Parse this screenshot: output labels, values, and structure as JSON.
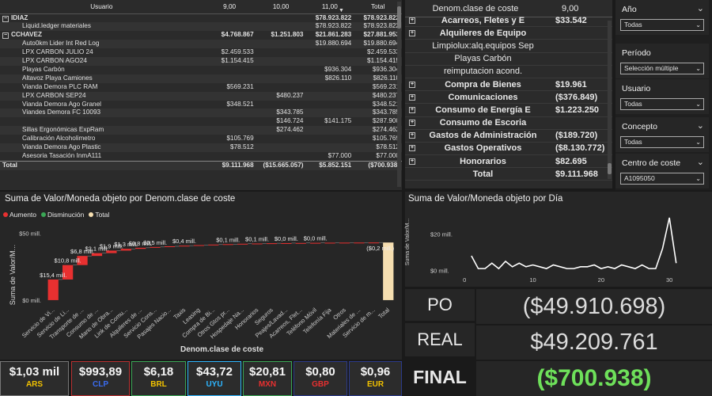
{
  "pivot": {
    "headers": [
      "Usuario",
      "9,00",
      "10,00",
      "11,00",
      "Total"
    ],
    "rows": [
      {
        "type": "grp",
        "expand": "⊟",
        "label": "IDIAZ",
        "c1": "",
        "c2": "",
        "c3": "$78.923.822",
        "c4": "$78.923.822"
      },
      {
        "type": "item",
        "label": "Liquid.ledger materiales",
        "c1": "",
        "c2": "",
        "c3": "$78.923.822",
        "c4": "$78.923.822"
      },
      {
        "type": "grp",
        "expand": "⊟",
        "label": "CCHAVEZ",
        "c1": "$4.768.867",
        "c2": "$1.251.803",
        "c3": "$21.861.283",
        "c4": "$27.881.953"
      },
      {
        "type": "item",
        "label": "Auto0km Lider Int Red Log",
        "c1": "",
        "c2": "",
        "c3": "$19.880.694",
        "c4": "$19.880.694"
      },
      {
        "type": "item",
        "label": "LPX CARBON JULIO 24",
        "c1": "$2.459.533",
        "c2": "",
        "c3": "",
        "c4": "$2.459.533"
      },
      {
        "type": "item",
        "label": "LPX CARBON AGO24",
        "c1": "$1.154.415",
        "c2": "",
        "c3": "",
        "c4": "$1.154.415"
      },
      {
        "type": "item",
        "label": "Playas Carbón",
        "c1": "",
        "c2": "",
        "c3": "$936.304",
        "c4": "$936.304"
      },
      {
        "type": "item",
        "label": "Altavoz Playa Camiones",
        "c1": "",
        "c2": "",
        "c3": "$826.110",
        "c4": "$826.110"
      },
      {
        "type": "item",
        "label": "Vianda Demora PLC RAM",
        "c1": "$569.231",
        "c2": "",
        "c3": "",
        "c4": "$569.231"
      },
      {
        "type": "item",
        "label": "LPX CARBON SEP24",
        "c1": "",
        "c2": "$480.237",
        "c3": "",
        "c4": "$480.237"
      },
      {
        "type": "item",
        "label": "Vianda Demora Ago Granel",
        "c1": "$348.521",
        "c2": "",
        "c3": "",
        "c4": "$348.521"
      },
      {
        "type": "item",
        "label": "Viandes Demora FC 10093",
        "c1": "",
        "c2": "$343.785",
        "c3": "",
        "c4": "$343.785"
      },
      {
        "type": "item",
        "label": "",
        "c1": "",
        "c2": "$146.724",
        "c3": "$141.175",
        "c4": "$287.900"
      },
      {
        "type": "item",
        "label": "Sillas Ergonómicas ExpRam",
        "c1": "",
        "c2": "$274.462",
        "c3": "",
        "c4": "$274.462"
      },
      {
        "type": "item",
        "label": "Calibración Alcoholimetro",
        "c1": "$105.769",
        "c2": "",
        "c3": "",
        "c4": "$105.769"
      },
      {
        "type": "item",
        "label": "Vianda Demora Ago Plastic",
        "c1": "$78.512",
        "c2": "",
        "c3": "",
        "c4": "$78.512"
      },
      {
        "type": "item",
        "label": "Asesoria Tasación InmA111",
        "c1": "",
        "c2": "",
        "c3": "$77.000",
        "c4": "$77.000"
      },
      {
        "type": "tot",
        "label": "Total",
        "c1": "$9.111.968",
        "c2": "($15.665.057)",
        "c3": "$5.852.151",
        "c4": "($700.938)"
      }
    ]
  },
  "pivot2": {
    "header_label": "Denom.clase de coste",
    "header_value": "9,00",
    "rows": [
      {
        "type": "grp",
        "label": "Acarreos, Fletes y E",
        "value": "$33.542"
      },
      {
        "type": "grp",
        "label": "Alquileres de Equipo",
        "value": ""
      },
      {
        "type": "sub",
        "label": "Limpiolux:alq.equipos Sep",
        "value": ""
      },
      {
        "type": "sub",
        "label": "Playas Carbón",
        "value": ""
      },
      {
        "type": "sub",
        "label": "reimputacion acond.",
        "value": ""
      },
      {
        "type": "grp",
        "label": "Compra de Bienes",
        "value": "$19.961"
      },
      {
        "type": "grp",
        "label": "Comunicaciones",
        "value": "($376.849)"
      },
      {
        "type": "grp",
        "label": "Consumo de Energía E",
        "value": "$1.223.250"
      },
      {
        "type": "grp",
        "label": "Consumo de Escoria",
        "value": ""
      },
      {
        "type": "grp",
        "label": "Gastos de Administración",
        "value": "($189.720)"
      },
      {
        "type": "grp",
        "label": "Gastos Operativos",
        "value": "($8.130.772)"
      },
      {
        "type": "grp",
        "label": "Honorarios",
        "value": "$82.695"
      },
      {
        "type": "tot",
        "label": "Total",
        "value": "$9.111.968"
      }
    ]
  },
  "slicers": [
    {
      "title": "Año",
      "value": "Todas"
    },
    {
      "title": "Período",
      "value": "Selección múltiple"
    },
    {
      "title": "Usuario",
      "value": "Todas"
    },
    {
      "title": "Concepto",
      "value": "Todas"
    },
    {
      "title": "Centro de coste",
      "value": "A1095050"
    }
  ],
  "waterfall": {
    "title": "Suma de Valor/Moneda objeto por Denom.clase de coste",
    "legend": [
      {
        "label": "Aumento",
        "color": "#e83030"
      },
      {
        "label": "Disminución",
        "color": "#3aa655"
      },
      {
        "label": "Total",
        "color": "#f5deb0"
      }
    ],
    "ylabel": "Suma de Valor/M...",
    "xlabel": "Denom.clase de coste"
  },
  "chart_data": [
    {
      "type": "bar",
      "subtype": "waterfall",
      "title": "Suma de Valor/Moneda objeto por Denom.clase de coste",
      "xlabel": "Denom.clase de coste",
      "ylabel": "Suma de Valor/M...",
      "y_ticks": [
        "$0 mill.",
        "$50 mill."
      ],
      "ylim": [
        -3,
        55
      ],
      "categories": [
        "Servicio de Vi...",
        "Servicio de Li...",
        "Transporte de ...",
        "Consumo de ...",
        "Mano de Obra...",
        "Link de Comu...",
        "Alquileres de ...",
        "Servicio Cons...",
        "Pasajes Nacio...",
        "Taxis",
        "Leasing",
        "Compra de Bi...",
        "Otros Gtos pr...",
        "Hospedaje Na...",
        "Honorarios",
        "Seguros",
        "Peajes/Lavad...",
        "Acarreos, Flet...",
        "Teléfono Móvil",
        "Telefonía Fija",
        "Otros",
        "Materiales de ...",
        "Servicio de m...",
        "Total"
      ],
      "values": [
        15.4,
        10.8,
        6.8,
        2.1,
        1.9,
        1.3,
        0.8,
        0.6,
        0.5,
        0.5,
        0.4,
        0.4,
        0.3,
        0.3,
        0.2,
        0.2,
        0.1,
        0.1,
        0.1,
        0.1,
        0.05,
        0.05,
        0.05,
        -0.2
      ],
      "data_labels": [
        "$15,4 mill.",
        "$10,8 mill.",
        "$6,8 mill.",
        "$2,1 mill.",
        "$1,9 mill.",
        "$1,3 mill.",
        "$0,8 mill.",
        "$0,5 mill.",
        "$0,4 mill.",
        "$0,1 mill.",
        "$0,1 mill.",
        "$0,0 mill.",
        "$0,0 mill.",
        "($0,2 mill.)"
      ],
      "label_at": [
        0,
        1,
        2,
        3,
        4,
        5,
        6,
        7,
        9,
        12,
        14,
        16,
        18,
        23
      ],
      "colors": {
        "increase": "#e83030",
        "decrease": "#3aa655",
        "total": "#f5deb0"
      }
    },
    {
      "type": "line",
      "title": "Suma de Valor/Moneda objeto por Día",
      "xlabel": "",
      "ylabel": "Suma de Valor/M...",
      "x_ticks": [
        0,
        10,
        20,
        30
      ],
      "y_ticks": [
        "$0 mill.",
        "$20 mill."
      ],
      "xlim": [
        -2,
        33
      ],
      "ylim": [
        -2,
        32
      ],
      "x": [
        1,
        2,
        3,
        4,
        5,
        6,
        7,
        8,
        9,
        10,
        11,
        12,
        13,
        14,
        15,
        16,
        17,
        18,
        19,
        20,
        21,
        22,
        23,
        24,
        25,
        26,
        27,
        28,
        29,
        30,
        31
      ],
      "y": [
        8,
        1,
        1,
        4,
        1,
        5,
        2,
        4,
        2,
        3,
        2,
        1,
        3,
        2,
        1,
        1,
        2,
        2,
        3,
        1,
        2,
        1,
        3,
        2,
        1,
        3,
        1,
        1,
        12,
        29,
        4
      ],
      "color": "#ffffff"
    }
  ],
  "linechart": {
    "title": "Suma de Valor/Moneda objeto por Día",
    "ylabel": "Suma de Valor/M..."
  },
  "kpis": [
    {
      "label": "PO",
      "value": "($49.910.698)",
      "color": "#dcdcdc"
    },
    {
      "label": "REAL",
      "value": "$49.209.761",
      "color": "#dcdcdc"
    },
    {
      "label": "FINAL",
      "value": "($700.938)",
      "color": "#6ee05a"
    }
  ],
  "currencies": [
    {
      "value": "$1,03 mil",
      "code": "ARS",
      "color": "#f2c200",
      "border": "#777777"
    },
    {
      "value": "$993,89",
      "code": "CLP",
      "color": "#3a6cf0",
      "border": "#b83030"
    },
    {
      "value": "$6,18",
      "code": "BRL",
      "color": "#f2c200",
      "border": "#3aa655"
    },
    {
      "value": "$43,72",
      "code": "UYU",
      "color": "#2db5ff",
      "border": "#2db5ff"
    },
    {
      "value": "$20,81",
      "code": "MXN",
      "color": "#e83030",
      "border": "#3aa655"
    },
    {
      "value": "$0,80",
      "code": "GBP",
      "color": "#e83030",
      "border": "#2b3a8a"
    },
    {
      "value": "$0,96",
      "code": "EUR",
      "color": "#f2c200",
      "border": "#2b3a8a"
    }
  ]
}
